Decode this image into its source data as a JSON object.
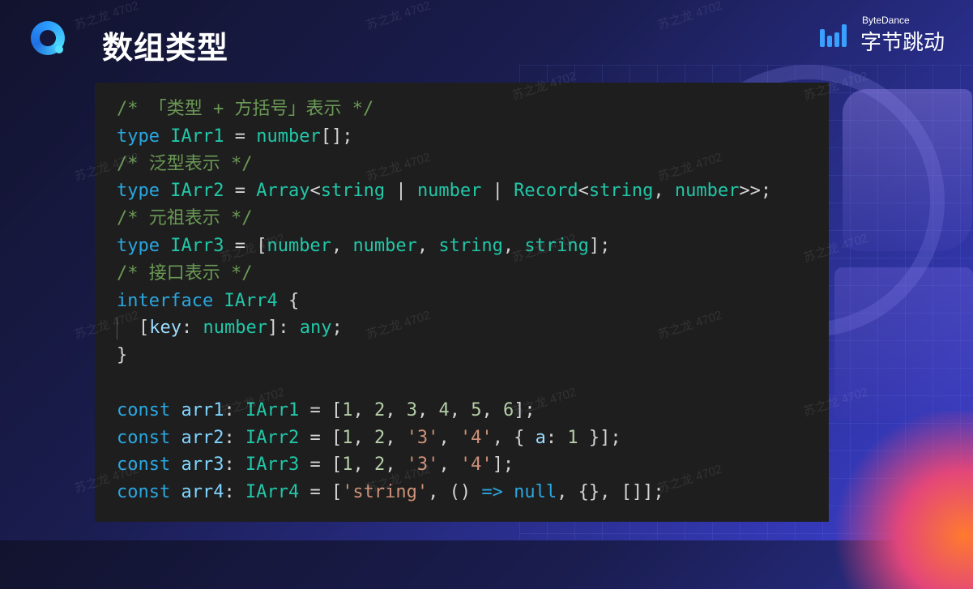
{
  "header": {
    "title": "数组类型",
    "brand_small": "ByteDance",
    "brand_big": "字节跳动"
  },
  "watermark": "苏之龙 4702",
  "code": {
    "lines": [
      [
        {
          "t": "/* 「类型 + 方括号」表示 */",
          "c": "comment"
        }
      ],
      [
        {
          "t": "type",
          "c": "kw"
        },
        {
          "t": " "
        },
        {
          "t": "IArr1",
          "c": "type"
        },
        {
          "t": " = "
        },
        {
          "t": "number",
          "c": "type"
        },
        {
          "t": "[];"
        }
      ],
      [
        {
          "t": "/* 泛型表示 */",
          "c": "comment"
        }
      ],
      [
        {
          "t": "type",
          "c": "kw"
        },
        {
          "t": " "
        },
        {
          "t": "IArr2",
          "c": "type"
        },
        {
          "t": " = "
        },
        {
          "t": "Array",
          "c": "type"
        },
        {
          "t": "<"
        },
        {
          "t": "string",
          "c": "type"
        },
        {
          "t": " | "
        },
        {
          "t": "number",
          "c": "type"
        },
        {
          "t": " | "
        },
        {
          "t": "Record",
          "c": "type"
        },
        {
          "t": "<"
        },
        {
          "t": "string",
          "c": "type"
        },
        {
          "t": ", "
        },
        {
          "t": "number",
          "c": "type"
        },
        {
          "t": ">>;"
        }
      ],
      [
        {
          "t": "/* 元祖表示 */",
          "c": "comment"
        }
      ],
      [
        {
          "t": "type",
          "c": "kw"
        },
        {
          "t": " "
        },
        {
          "t": "IArr3",
          "c": "type"
        },
        {
          "t": " = ["
        },
        {
          "t": "number",
          "c": "type"
        },
        {
          "t": ", "
        },
        {
          "t": "number",
          "c": "type"
        },
        {
          "t": ", "
        },
        {
          "t": "string",
          "c": "type"
        },
        {
          "t": ", "
        },
        {
          "t": "string",
          "c": "type"
        },
        {
          "t": "];"
        }
      ],
      [
        {
          "t": "/* 接口表示 */",
          "c": "comment"
        }
      ],
      [
        {
          "t": "interface",
          "c": "kw"
        },
        {
          "t": " "
        },
        {
          "t": "IArr4",
          "c": "type"
        },
        {
          "t": " {"
        }
      ],
      [
        {
          "t": "guide"
        },
        {
          "t": "["
        },
        {
          "t": "key",
          "c": "prop"
        },
        {
          "t": ": "
        },
        {
          "t": "number",
          "c": "type"
        },
        {
          "t": "]: "
        },
        {
          "t": "any",
          "c": "type"
        },
        {
          "t": ";"
        }
      ],
      [
        {
          "t": "}"
        }
      ],
      [],
      [
        {
          "t": "const",
          "c": "kw"
        },
        {
          "t": " "
        },
        {
          "t": "arr1",
          "c": "var"
        },
        {
          "t": ": "
        },
        {
          "t": "IArr1",
          "c": "type"
        },
        {
          "t": " = ["
        },
        {
          "t": "1",
          "c": "num"
        },
        {
          "t": ", "
        },
        {
          "t": "2",
          "c": "num"
        },
        {
          "t": ", "
        },
        {
          "t": "3",
          "c": "num"
        },
        {
          "t": ", "
        },
        {
          "t": "4",
          "c": "num"
        },
        {
          "t": ", "
        },
        {
          "t": "5",
          "c": "num"
        },
        {
          "t": ", "
        },
        {
          "t": "6",
          "c": "num"
        },
        {
          "t": "];"
        }
      ],
      [
        {
          "t": "const",
          "c": "kw"
        },
        {
          "t": " "
        },
        {
          "t": "arr2",
          "c": "var"
        },
        {
          "t": ": "
        },
        {
          "t": "IArr2",
          "c": "type"
        },
        {
          "t": " = ["
        },
        {
          "t": "1",
          "c": "num"
        },
        {
          "t": ", "
        },
        {
          "t": "2",
          "c": "num"
        },
        {
          "t": ", "
        },
        {
          "t": "'3'",
          "c": "str"
        },
        {
          "t": ", "
        },
        {
          "t": "'4'",
          "c": "str"
        },
        {
          "t": ", { "
        },
        {
          "t": "a",
          "c": "prop"
        },
        {
          "t": ": "
        },
        {
          "t": "1",
          "c": "num"
        },
        {
          "t": " }];"
        }
      ],
      [
        {
          "t": "const",
          "c": "kw"
        },
        {
          "t": " "
        },
        {
          "t": "arr3",
          "c": "var"
        },
        {
          "t": ": "
        },
        {
          "t": "IArr3",
          "c": "type"
        },
        {
          "t": " = ["
        },
        {
          "t": "1",
          "c": "num"
        },
        {
          "t": ", "
        },
        {
          "t": "2",
          "c": "num"
        },
        {
          "t": ", "
        },
        {
          "t": "'3'",
          "c": "str"
        },
        {
          "t": ", "
        },
        {
          "t": "'4'",
          "c": "str"
        },
        {
          "t": "];"
        }
      ],
      [
        {
          "t": "const",
          "c": "kw"
        },
        {
          "t": " "
        },
        {
          "t": "arr4",
          "c": "var"
        },
        {
          "t": ": "
        },
        {
          "t": "IArr4",
          "c": "type"
        },
        {
          "t": " = ["
        },
        {
          "t": "'string'",
          "c": "str"
        },
        {
          "t": ", () "
        },
        {
          "t": "=>",
          "c": "kw"
        },
        {
          "t": " "
        },
        {
          "t": "null",
          "c": "kw"
        },
        {
          "t": ", {}, []];"
        }
      ]
    ]
  }
}
